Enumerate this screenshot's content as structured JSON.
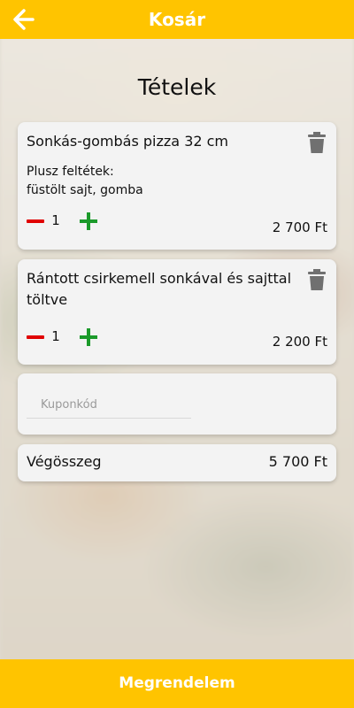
{
  "header": {
    "title": "Kosár",
    "back_icon": "arrow-left-icon",
    "background": "#ffc400"
  },
  "section_title": "Tételek",
  "items": [
    {
      "name": "Sonkás-gombás pizza 32 cm",
      "extras_label": "Plusz feltétek:",
      "extras": "füstölt sajt, gomba",
      "quantity": "1",
      "price": "2 700 Ft"
    },
    {
      "name": "Rántott csirkemell sonkával és sajttal töltve",
      "quantity": "1",
      "price": "2 200 Ft"
    }
  ],
  "coupon": {
    "placeholder": "Kuponkód",
    "value": ""
  },
  "total": {
    "label": "Végösszeg",
    "value": "5 700 Ft"
  },
  "order_button": {
    "label": "Megrendelem"
  },
  "colors": {
    "accent": "#ffc400",
    "minus": "#e00000",
    "plus": "#1b9a2a",
    "card": "#f3f3f3"
  },
  "icons": {
    "delete": "trash-icon",
    "decrease": "minus-icon",
    "increase": "plus-icon"
  }
}
